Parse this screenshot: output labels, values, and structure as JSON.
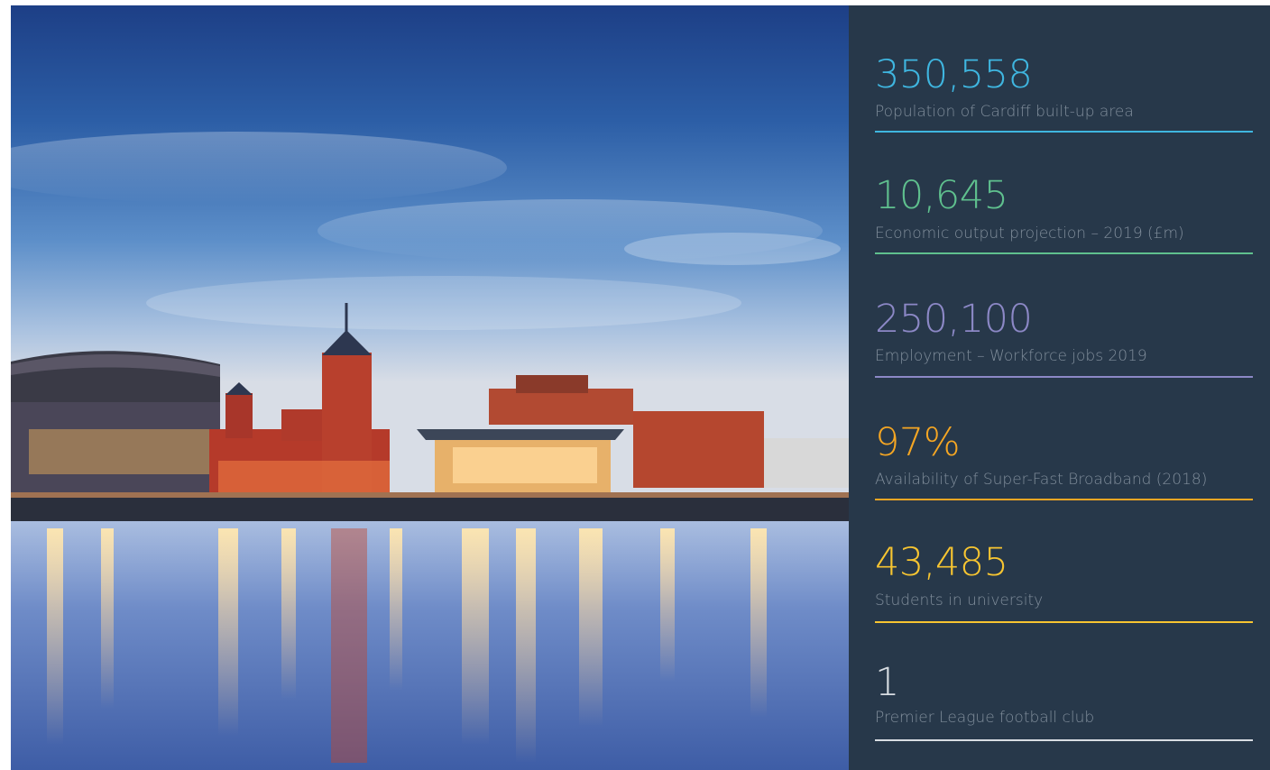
{
  "colors": {
    "panel_bg": "#27384a",
    "label_text": "#8a97a4",
    "stat_cyan": "#3fb6e0",
    "stat_green": "#5fc08e",
    "stat_lavender": "#8c88c6",
    "stat_orange": "#f5a623",
    "stat_yellow": "#f7c531",
    "stat_white": "#d8dde2"
  },
  "photo": {
    "icon": "cardiff-bay-waterfront-photo"
  },
  "stats": [
    {
      "value": "350,558",
      "label": "Population of Cardiff built-up area",
      "color": "#3fb6e0"
    },
    {
      "value": "10,645",
      "label": "Economic output projection – 2019 (£m)",
      "color": "#5fc08e"
    },
    {
      "value": "250,100",
      "label": "Employment – Workforce jobs 2019",
      "color": "#8c88c6"
    },
    {
      "value": "97%",
      "label": "Availability of Super-Fast Broadband (2018)",
      "color": "#f5a623"
    },
    {
      "value": "43,485",
      "label": "Students in university",
      "color": "#f7c531"
    },
    {
      "value": "1",
      "label": "Premier League football club",
      "color": "#d8dde2"
    }
  ]
}
